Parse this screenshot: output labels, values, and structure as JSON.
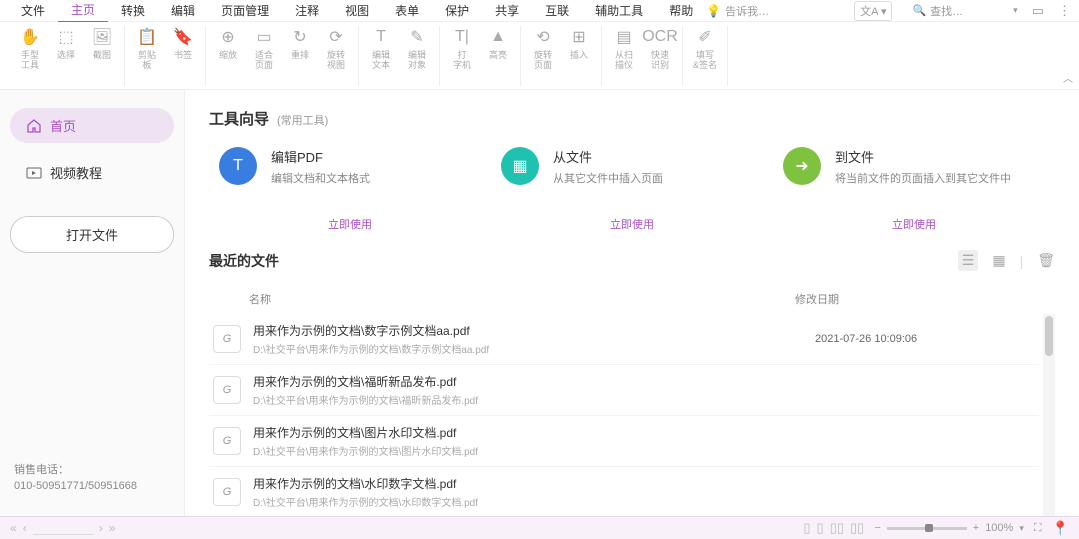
{
  "menubar": {
    "items": [
      "文件",
      "主页",
      "转换",
      "编辑",
      "页面管理",
      "注释",
      "视图",
      "表单",
      "保护",
      "共享",
      "互联",
      "辅助工具",
      "帮助"
    ],
    "active_index": 1,
    "hint": "告诉我…",
    "search_placeholder": "查找…"
  },
  "ribbon": {
    "groups": [
      [
        {
          "icon": "✋",
          "label": "手型\n工具"
        },
        {
          "icon": "⬚",
          "label": "选择"
        },
        {
          "icon": "🖼",
          "label": "截图"
        }
      ],
      [
        {
          "icon": "📋",
          "label": "剪贴\n板"
        },
        {
          "icon": "🔖",
          "label": "书签"
        }
      ],
      [
        {
          "icon": "⊕",
          "label": "缩放"
        },
        {
          "icon": "▭",
          "label": "适合\n页面"
        },
        {
          "icon": "↻",
          "label": "重排"
        },
        {
          "icon": "⟳",
          "label": "旋转\n视图"
        }
      ],
      [
        {
          "icon": "T",
          "label": "编辑\n文本"
        },
        {
          "icon": "✎",
          "label": "编辑\n对象"
        }
      ],
      [
        {
          "icon": "T|",
          "label": "打\n字机"
        },
        {
          "icon": "▲",
          "label": "高亮"
        }
      ],
      [
        {
          "icon": "⟲",
          "label": "旋转\n页面"
        },
        {
          "icon": "⊞",
          "label": "插入"
        }
      ],
      [
        {
          "icon": "▤",
          "label": "从扫\n描仪"
        },
        {
          "icon": "OCR",
          "label": "快速\n识别"
        }
      ],
      [
        {
          "icon": "✐",
          "label": "填写\n&签名"
        }
      ]
    ],
    "chevron": "︿"
  },
  "sidebar": {
    "home": "首页",
    "video": "视频教程",
    "open": "打开文件",
    "footer": {
      "label": "销售电话：",
      "phone": "010-50951771/50951668"
    }
  },
  "wizard": {
    "title": "工具向导",
    "subtitle": "(常用工具)",
    "cards": [
      {
        "title": "编辑PDF",
        "desc": "编辑文档和文本格式",
        "action": "立即使用",
        "color": "c-blue",
        "icon": "T"
      },
      {
        "title": "从文件",
        "desc": "从其它文件中插入页面",
        "action": "立即使用",
        "color": "c-teal",
        "icon": "▦"
      },
      {
        "title": "到文件",
        "desc": "将当前文件的页面插入到其它文件中",
        "action": "立即使用",
        "color": "c-green",
        "icon": "➜"
      }
    ]
  },
  "recent": {
    "title": "最近的文件",
    "col_name": "名称",
    "col_date": "修改日期",
    "files": [
      {
        "name": "用来作为示例的文档\\数字示例文档aa.pdf",
        "path": "D:\\社交平台\\用来作为示例的文档\\数字示例文档aa.pdf",
        "date": "2021-07-26 10:09:06"
      },
      {
        "name": "用来作为示例的文档\\福昕新品发布.pdf",
        "path": "D:\\社交平台\\用来作为示例的文档\\福昕新品发布.pdf",
        "date": ""
      },
      {
        "name": "用来作为示例的文档\\图片水印文档.pdf",
        "path": "D:\\社交平台\\用来作为示例的文档\\图片水印文档.pdf",
        "date": ""
      },
      {
        "name": "用来作为示例的文档\\水印数字文档.pdf",
        "path": "D:\\社交平台\\用来作为示例的文档\\水印数字文档.pdf",
        "date": ""
      }
    ]
  },
  "statusbar": {
    "zoom": "100%"
  }
}
